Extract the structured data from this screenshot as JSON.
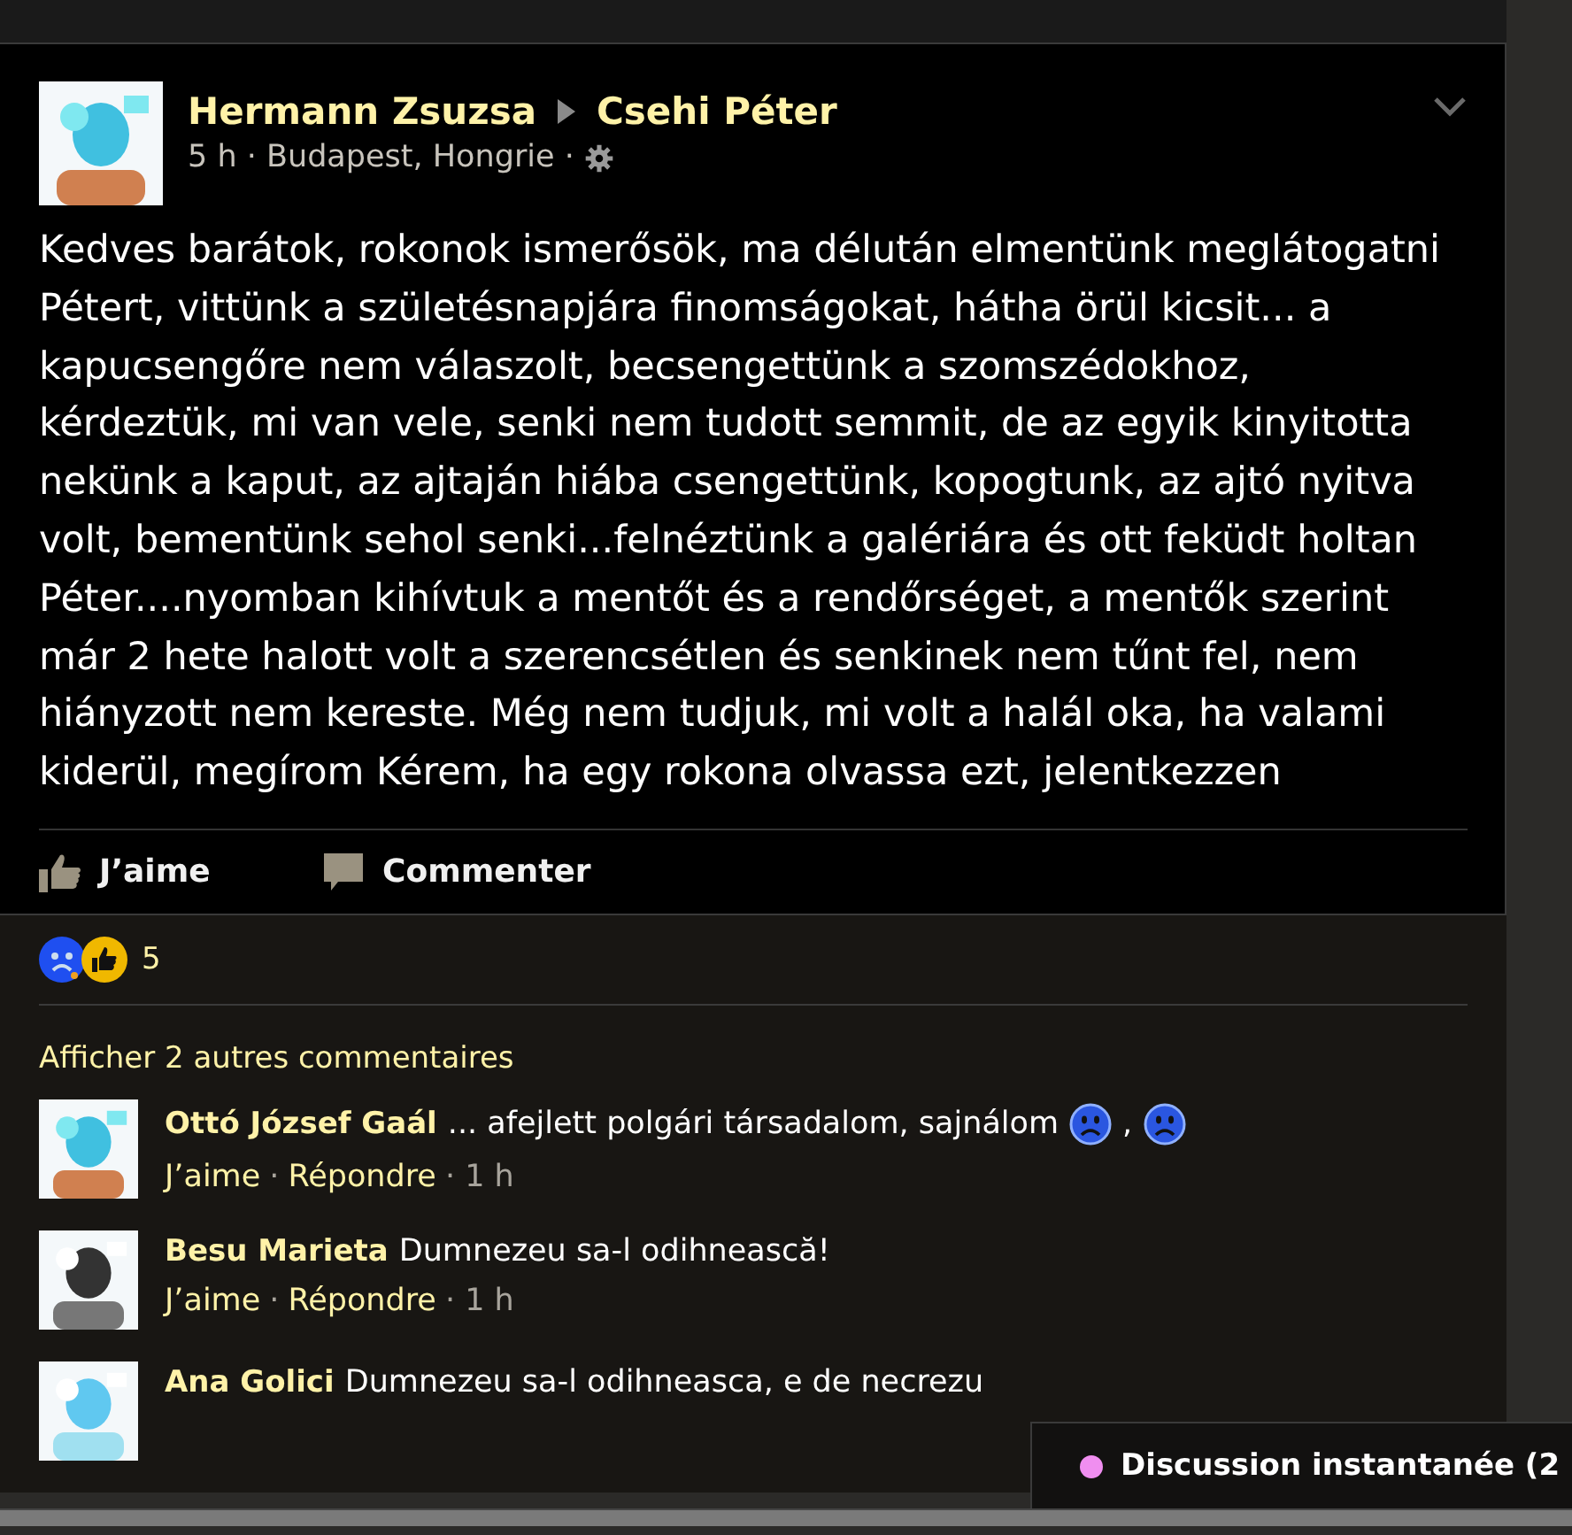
{
  "post": {
    "author": "Hermann Zsuzsa",
    "target": "Csehi Péter",
    "time": "5 h",
    "separator": "·",
    "location": "Budapest, Hongrie",
    "text": "Kedves barátok, rokonok ismerősök, ma délután elmentünk meglátogatni Pétert, vittünk a születésnapjára finomságokat, hátha örül kicsit... a kapucsengőre nem válaszolt, becsengettünk a szomszédokhoz, kérdeztük, mi van vele, senki nem tudott semmit, de az egyik kinyitotta nekünk a kaput, az ajtaján hiába csengettünk, kopogtunk, az ajtó nyitva volt, bementünk sehol senki...felnéztünk a galériára és ott feküdt holtan Péter....nyomban kihívtuk a mentőt és a rendőrséget, a mentők szerint már 2 hete halott volt a szerencsétlen és senkinek nem tűnt fel, nem hiányzott nem kereste. Még nem tudjuk, mi volt a halál oka, ha valami kiderül, megírom Kérem, ha egy rokona olvassa ezt, jelentkezzen",
    "actions": [
      {
        "kind": "like",
        "label": "J’aime"
      },
      {
        "kind": "comment",
        "label": "Commenter"
      }
    ]
  },
  "reactions": {
    "count": "5"
  },
  "more_comments": "Afficher 2 autres commentaires",
  "comments": [
    {
      "author": "Ottó József Gaál",
      "parts": [
        {
          "kind": "text",
          "text": "... afejlett polgári társadalom, sajnálom"
        },
        {
          "kind": "sad-emoji"
        },
        {
          "kind": "text",
          "text": ","
        },
        {
          "kind": "sad-emoji"
        }
      ],
      "like": "J’aime",
      "separator": "·",
      "reply": "Répondre",
      "time": "1 h"
    },
    {
      "author": "Besu Marieta",
      "parts": [
        {
          "kind": "text",
          "text": "Dumnezeu sa-l odihnească!"
        }
      ],
      "like": "J’aime",
      "separator": "·",
      "reply": "Répondre",
      "time": "1 h"
    },
    {
      "author": "Ana Golici",
      "parts": [
        {
          "kind": "text",
          "text": "Dumnezeu sa-l odihneasca, e de necrezu"
        }
      ]
    }
  ],
  "chat": {
    "label": "Discussion instantanée (2"
  }
}
